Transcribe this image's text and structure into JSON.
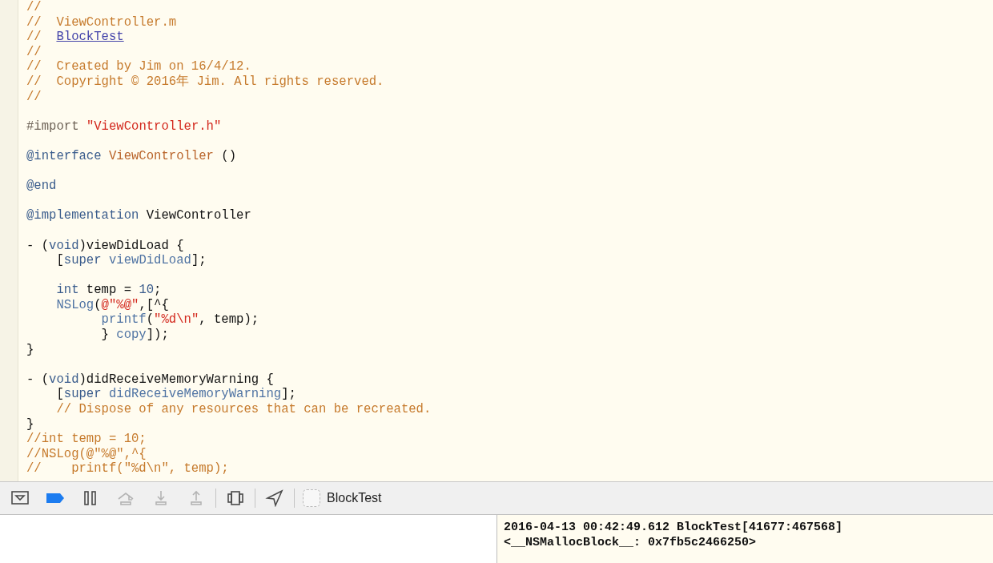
{
  "editor": {
    "lines": [
      {
        "kind": "code",
        "tokens": [
          {
            "kind": "comment",
            "s": "//"
          }
        ]
      },
      {
        "kind": "code",
        "tokens": [
          {
            "kind": "comment",
            "s": "//  ViewController.m"
          }
        ]
      },
      {
        "kind": "code",
        "tokens": [
          {
            "kind": "comment",
            "s": "//  "
          },
          {
            "kind": "link",
            "s": "BlockTest"
          }
        ]
      },
      {
        "kind": "code",
        "tokens": [
          {
            "kind": "comment",
            "s": "//"
          }
        ]
      },
      {
        "kind": "code",
        "tokens": [
          {
            "kind": "comment",
            "s": "//  Created by Jim on 16/4/12."
          }
        ]
      },
      {
        "kind": "code",
        "tokens": [
          {
            "kind": "comment",
            "s": "//  Copyright © 2016年 Jim. All rights reserved."
          }
        ]
      },
      {
        "kind": "code",
        "tokens": [
          {
            "kind": "comment",
            "s": "//"
          }
        ]
      },
      {
        "kind": "blank"
      },
      {
        "kind": "code",
        "tokens": [
          {
            "kind": "preproc",
            "s": "#import "
          },
          {
            "kind": "string",
            "s": "\"ViewController.h\""
          }
        ]
      },
      {
        "kind": "blank"
      },
      {
        "kind": "code",
        "tokens": [
          {
            "kind": "keyword",
            "s": "@interface "
          },
          {
            "kind": "classname",
            "s": "ViewController"
          },
          {
            "kind": "plain",
            "s": " ()"
          }
        ]
      },
      {
        "kind": "blank"
      },
      {
        "kind": "code",
        "tokens": [
          {
            "kind": "keyword",
            "s": "@end"
          }
        ]
      },
      {
        "kind": "blank"
      },
      {
        "kind": "code",
        "tokens": [
          {
            "kind": "keyword",
            "s": "@implementation"
          },
          {
            "kind": "plain",
            "s": " ViewController"
          }
        ]
      },
      {
        "kind": "blank"
      },
      {
        "kind": "code",
        "tokens": [
          {
            "kind": "plain",
            "s": "- ("
          },
          {
            "kind": "keyword",
            "s": "void"
          },
          {
            "kind": "plain",
            "s": ")viewDidLoad {"
          }
        ]
      },
      {
        "kind": "code",
        "tokens": [
          {
            "kind": "plain",
            "s": "    ["
          },
          {
            "kind": "keyword",
            "s": "super "
          },
          {
            "kind": "method",
            "s": "viewDidLoad"
          },
          {
            "kind": "plain",
            "s": "];"
          }
        ]
      },
      {
        "kind": "blank"
      },
      {
        "kind": "code",
        "tokens": [
          {
            "kind": "keyword",
            "s": "    int"
          },
          {
            "kind": "plain",
            "s": " temp = "
          },
          {
            "kind": "number",
            "s": "10"
          },
          {
            "kind": "plain",
            "s": ";"
          }
        ]
      },
      {
        "kind": "code",
        "tokens": [
          {
            "kind": "method",
            "s": "    NSLog"
          },
          {
            "kind": "plain",
            "s": "("
          },
          {
            "kind": "string",
            "s": "@\"%@\""
          },
          {
            "kind": "plain",
            "s": ",[^{"
          }
        ]
      },
      {
        "kind": "code",
        "tokens": [
          {
            "kind": "method",
            "s": "          printf"
          },
          {
            "kind": "plain",
            "s": "("
          },
          {
            "kind": "string",
            "s": "\"%d\\n\""
          },
          {
            "kind": "plain",
            "s": ", temp);"
          }
        ]
      },
      {
        "kind": "code",
        "tokens": [
          {
            "kind": "plain",
            "s": "          } "
          },
          {
            "kind": "method",
            "s": "copy"
          },
          {
            "kind": "plain",
            "s": "]);"
          }
        ]
      },
      {
        "kind": "code",
        "tokens": [
          {
            "kind": "plain",
            "s": "}"
          }
        ]
      },
      {
        "kind": "blank"
      },
      {
        "kind": "code",
        "tokens": [
          {
            "kind": "plain",
            "s": "- ("
          },
          {
            "kind": "keyword",
            "s": "void"
          },
          {
            "kind": "plain",
            "s": ")didReceiveMemoryWarning {"
          }
        ]
      },
      {
        "kind": "code",
        "tokens": [
          {
            "kind": "plain",
            "s": "    ["
          },
          {
            "kind": "keyword",
            "s": "super "
          },
          {
            "kind": "method",
            "s": "didReceiveMemoryWarning"
          },
          {
            "kind": "plain",
            "s": "];"
          }
        ]
      },
      {
        "kind": "code",
        "tokens": [
          {
            "kind": "comment",
            "s": "    // Dispose of any resources that can be recreated."
          }
        ]
      },
      {
        "kind": "code",
        "tokens": [
          {
            "kind": "plain",
            "s": "}"
          }
        ]
      },
      {
        "kind": "code",
        "tokens": [
          {
            "kind": "comment",
            "s": "//int temp = 10;"
          }
        ]
      },
      {
        "kind": "code",
        "tokens": [
          {
            "kind": "comment",
            "s": "//NSLog(@\"%@\",^{"
          }
        ]
      },
      {
        "kind": "code",
        "tokens": [
          {
            "kind": "comment",
            "s": "//    printf(\"%d\\n\", temp);"
          }
        ]
      }
    ]
  },
  "debug_bar": {
    "groups": [
      {
        "items": [
          {
            "kind": "toggle-console",
            "disabled": false,
            "on": false
          },
          {
            "kind": "breakpoints",
            "disabled": false,
            "on": true
          },
          {
            "kind": "pause",
            "disabled": false,
            "on": false
          },
          {
            "kind": "step-over",
            "disabled": true,
            "on": false
          },
          {
            "kind": "step-into",
            "disabled": true,
            "on": false
          },
          {
            "kind": "step-out",
            "disabled": true,
            "on": false
          }
        ]
      },
      {
        "items": [
          {
            "kind": "view-debugger",
            "disabled": false,
            "on": false
          }
        ]
      },
      {
        "items": [
          {
            "kind": "location",
            "disabled": false,
            "on": false
          }
        ]
      }
    ],
    "target": {
      "label": "BlockTest"
    }
  },
  "console": {
    "lines": [
      "2016-04-13 00:42:49.612 BlockTest[41677:467568]",
      "<__NSMallocBlock__: 0x7fb5c2466250>"
    ]
  }
}
